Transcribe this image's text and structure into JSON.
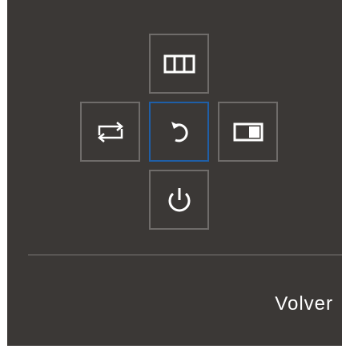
{
  "osd": {
    "buttons": {
      "up": {
        "icon": "columns-icon"
      },
      "left": {
        "icon": "swap-arrows-icon"
      },
      "center": {
        "icon": "return-icon",
        "state": "selected"
      },
      "right": {
        "icon": "picture-in-picture-icon"
      },
      "down": {
        "icon": "power-icon"
      }
    },
    "action_label": "Volver",
    "colors": {
      "background": "#3b3836",
      "button_border": "#6f6c6a",
      "selected_border": "#1f5fa8",
      "icon": "#ffffff"
    }
  }
}
